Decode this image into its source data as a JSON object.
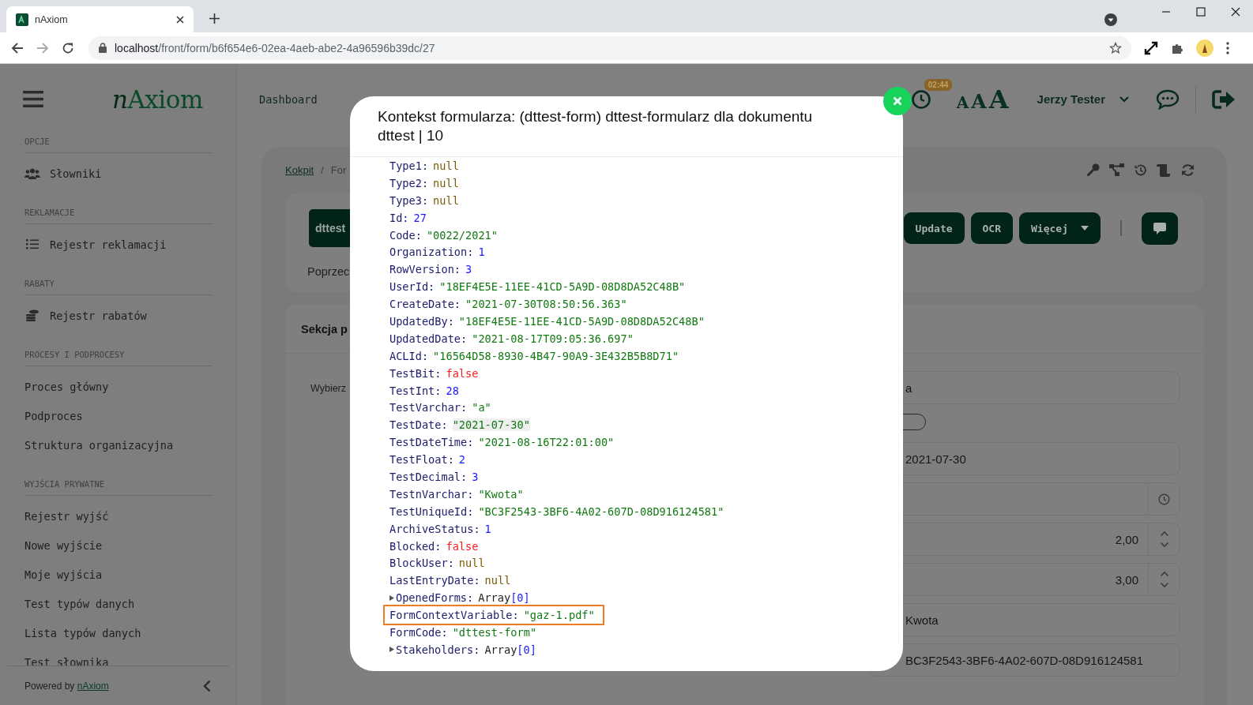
{
  "browser": {
    "tab_title": "nAxiom",
    "url_host": "localhost",
    "url_path": "/front/form/b6f654e6-02ea-4aeb-abe2-4a96596b39dc/27"
  },
  "sidebar": {
    "logo_prefix": "n",
    "logo_name": "Axiom",
    "sections": [
      {
        "title": "OPCJE",
        "items": [
          {
            "label": "Słowniki"
          }
        ]
      },
      {
        "title": "REKLAMACJE",
        "items": [
          {
            "label": "Rejestr reklamacji"
          }
        ]
      },
      {
        "title": "RABATY",
        "items": [
          {
            "label": "Rejestr rabatów"
          }
        ]
      },
      {
        "title": "PROCESY I PODPROCESY",
        "items": [
          {
            "label": "Proces główny"
          },
          {
            "label": "Podproces"
          },
          {
            "label": "Struktura organizacyjna"
          }
        ]
      },
      {
        "title": "WYJŚCIA PRYWATNE",
        "items": [
          {
            "label": "Rejestr wyjść"
          },
          {
            "label": "Nowe wyjście"
          },
          {
            "label": "Moje wyjścia"
          },
          {
            "label": "Test typów danych"
          },
          {
            "label": "Lista typów danych"
          },
          {
            "label": "Test słownika"
          }
        ]
      }
    ],
    "footer_text": "Powered by",
    "footer_link": "nAxiom"
  },
  "header": {
    "nav_link": "Dashboard",
    "timer": "02:44",
    "font_sizes": [
      "A",
      "A",
      "A"
    ],
    "user": "Jerzy Tester"
  },
  "page": {
    "breadcrumb": [
      {
        "label": "Kokpit",
        "link": true
      },
      {
        "label": "For",
        "link": false
      }
    ],
    "breadcrumb_separator": "/",
    "form_button": "dttest",
    "prev_label": "Poprzec",
    "actions": [
      {
        "label": "Update",
        "dropdown": false
      },
      {
        "label": "OCR",
        "dropdown": false
      },
      {
        "label": "Więcej",
        "dropdown": true
      }
    ],
    "section_title": "Sekcja p",
    "field_label": "Wybierz",
    "fields": [
      {
        "kind": "text",
        "value": "a"
      },
      {
        "kind": "toggle",
        "on": false
      },
      {
        "kind": "text",
        "value": "2021-07-30"
      },
      {
        "kind": "time"
      },
      {
        "kind": "number",
        "value": "2,00"
      },
      {
        "kind": "number",
        "value": "3,00"
      },
      {
        "kind": "text",
        "value": "Kwota"
      },
      {
        "kind": "text",
        "value": "BC3F2543-3BF6-4A02-607D-08D916124581"
      }
    ]
  },
  "modal": {
    "title": "Kontekst formularza: (dttest-form) dttest-formularz dla dokumentu dttest | 10",
    "rows": [
      {
        "key": "Type1:",
        "kind": "null",
        "value": "null",
        "hovered": false,
        "highlighted": false
      },
      {
        "key": "Type2:",
        "kind": "null",
        "value": "null",
        "hovered": false,
        "highlighted": false
      },
      {
        "key": "Type3:",
        "kind": "null",
        "value": "null",
        "hovered": false,
        "highlighted": false
      },
      {
        "key": "Id:",
        "kind": "number",
        "value": "27",
        "hovered": false,
        "highlighted": false
      },
      {
        "key": "Code:",
        "kind": "string",
        "value": "\"0022/2021\"",
        "hovered": false,
        "highlighted": false
      },
      {
        "key": "Organization:",
        "kind": "number",
        "value": "1",
        "hovered": false,
        "highlighted": false
      },
      {
        "key": "RowVersion:",
        "kind": "number",
        "value": "3",
        "hovered": false,
        "highlighted": false
      },
      {
        "key": "UserId:",
        "kind": "string",
        "value": "\"18EF4E5E-11EE-41CD-5A9D-08D8DA52C48B\"",
        "hovered": false,
        "highlighted": false
      },
      {
        "key": "CreateDate:",
        "kind": "string",
        "value": "\"2021-07-30T08:50:56.363\"",
        "hovered": false,
        "highlighted": false
      },
      {
        "key": "UpdatedBy:",
        "kind": "string",
        "value": "\"18EF4E5E-11EE-41CD-5A9D-08D8DA52C48B\"",
        "hovered": false,
        "highlighted": false
      },
      {
        "key": "UpdatedDate:",
        "kind": "string",
        "value": "\"2021-08-17T09:05:36.697\"",
        "hovered": false,
        "highlighted": false
      },
      {
        "key": "ACLId:",
        "kind": "string",
        "value": "\"16564D58-8930-4B47-90A9-3E432B5B8D71\"",
        "hovered": false,
        "highlighted": false
      },
      {
        "key": "TestBit:",
        "kind": "boolean",
        "value": "false",
        "hovered": false,
        "highlighted": false
      },
      {
        "key": "TestInt:",
        "kind": "number",
        "value": "28",
        "hovered": false,
        "highlighted": false
      },
      {
        "key": "TestVarchar:",
        "kind": "string",
        "value": "\"a\"",
        "hovered": false,
        "highlighted": false
      },
      {
        "key": "TestDate:",
        "kind": "string",
        "value": "\"2021-07-30\"",
        "hovered": true,
        "highlighted": false
      },
      {
        "key": "TestDateTime:",
        "kind": "string",
        "value": "\"2021-08-16T22:01:00\"",
        "hovered": false,
        "highlighted": false
      },
      {
        "key": "TestFloat:",
        "kind": "number",
        "value": "2",
        "hovered": false,
        "highlighted": false
      },
      {
        "key": "TestDecimal:",
        "kind": "number",
        "value": "3",
        "hovered": false,
        "highlighted": false
      },
      {
        "key": "TestnVarchar:",
        "kind": "string",
        "value": "\"Kwota\"",
        "hovered": false,
        "highlighted": false
      },
      {
        "key": "TestUniqueId:",
        "kind": "string",
        "value": "\"BC3F2543-3BF6-4A02-607D-08D916124581\"",
        "hovered": false,
        "highlighted": false
      },
      {
        "key": "ArchiveStatus:",
        "kind": "number",
        "value": "1",
        "hovered": false,
        "highlighted": false
      },
      {
        "key": "Blocked:",
        "kind": "boolean",
        "value": "false",
        "hovered": false,
        "highlighted": false
      },
      {
        "key": "BlockUser:",
        "kind": "null",
        "value": "null",
        "hovered": false,
        "highlighted": false
      },
      {
        "key": "LastEntryDate:",
        "kind": "null",
        "value": "null",
        "hovered": false,
        "highlighted": false
      },
      {
        "key": "OpenedForms:",
        "kind": "array",
        "type_name": "Array",
        "value": "[0]",
        "expanded": false,
        "hovered": false,
        "highlighted": false
      },
      {
        "key": "FormContextVariable:",
        "kind": "string",
        "value": "\"gaz-1.pdf\"",
        "hovered": false,
        "highlighted": true
      },
      {
        "key": "FormCode:",
        "kind": "string",
        "value": "\"dttest-form\"",
        "hovered": false,
        "highlighted": false
      },
      {
        "key": "Stakeholders:",
        "kind": "array",
        "type_name": "Array",
        "value": "[0]",
        "expanded": false,
        "hovered": false,
        "highlighted": false
      }
    ]
  }
}
